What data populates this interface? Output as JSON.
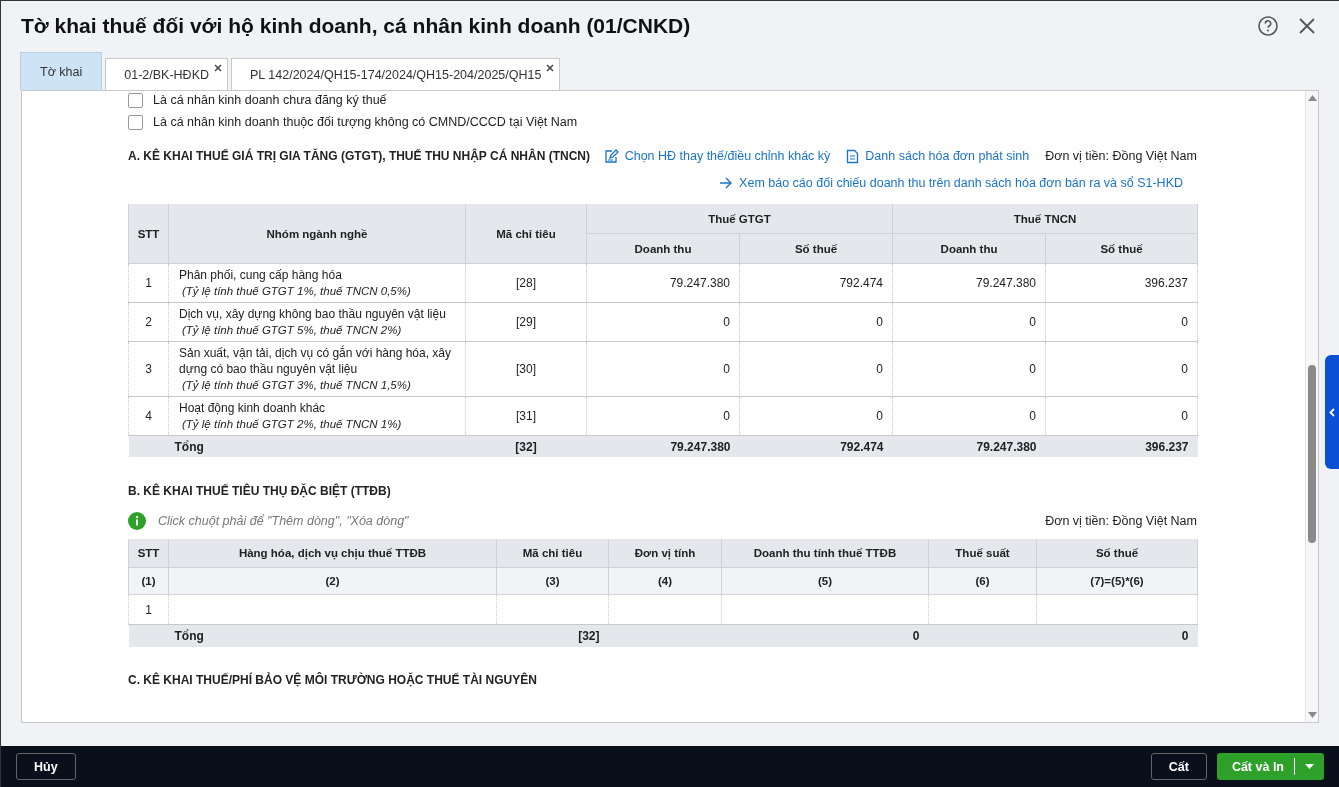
{
  "window": {
    "title": "Tờ khai thuế đối với hộ kinh doanh, cá nhân kinh doanh (01/CNKD)"
  },
  "tabs": [
    {
      "label": "Tờ khai",
      "selected": true,
      "closable": false
    },
    {
      "label": "01-2/BK-HĐKD",
      "selected": false,
      "closable": true
    },
    {
      "label": "PL 142/2024/QH15-174/2024/QH15-204/2025/QH15",
      "selected": false,
      "closable": true
    }
  ],
  "checkboxes": [
    {
      "label": "Là cá nhân kinh doanh chưa đăng ký thuế",
      "checked": false
    },
    {
      "label": "Là cá nhân kinh doanh thuộc đối tượng không có CMND/CCCD tại Việt Nam",
      "checked": false
    }
  ],
  "section_a": {
    "heading": "A. KÊ KHAI THUẾ GIÁ TRỊ GIA TĂNG (GTGT), THUẾ THU NHẬP CÁ NHÂN (TNCN)",
    "links": [
      {
        "label": "Chọn HĐ thay thế/điều chỉnh khác kỳ",
        "kind": "edit"
      },
      {
        "label": "Danh sách hóa đơn phát sinh",
        "kind": "list"
      }
    ],
    "currency": "Đơn vị tiền: Đồng Việt Nam",
    "report_link": {
      "label": "Xem báo cáo đối chiếu doanh thu trên danh sách hóa đơn bán ra và sổ S1-HKD",
      "kind": "arrow"
    },
    "columns": {
      "stt": "STT",
      "group": "Nhóm ngành nghề",
      "code": "Mã chỉ tiêu",
      "gtgt": "Thuế GTGT",
      "tncn": "Thuế TNCN",
      "sub": [
        "Doanh thu",
        "Số thuế",
        "Doanh thu",
        "Số thuế"
      ]
    },
    "rows": [
      {
        "stt": "1",
        "name": "Phân phối, cung cấp hàng hóa",
        "rate": "(Tỷ lệ tính thuế GTGT 1%, thuế TNCN 0,5%)",
        "code": "[28]",
        "values": [
          "79.247.380",
          "792.474",
          "79.247.380",
          "396.237"
        ]
      },
      {
        "stt": "2",
        "name": "Dịch vụ, xây dựng không bao thầu nguyên vật liệu",
        "rate": "(Tỷ lệ tính thuế GTGT 5%, thuế TNCN 2%)",
        "code": "[29]",
        "values": [
          "0",
          "0",
          "0",
          "0"
        ]
      },
      {
        "stt": "3",
        "name": "Sản xuất, vận tải, dịch vụ có gắn với hàng hóa, xây dựng có bao thầu nguyên vật liệu",
        "rate": "(Tỷ lệ tính thuế GTGT 3%, thuế TNCN 1,5%)",
        "code": "[30]",
        "values": [
          "0",
          "0",
          "0",
          "0"
        ]
      },
      {
        "stt": "4",
        "name": "Hoạt động kinh doanh khác",
        "rate": "(Tỷ lệ tính thuế GTGT 2%, thuế TNCN 1%)",
        "code": "[31]",
        "values": [
          "0",
          "0",
          "0",
          "0"
        ]
      }
    ],
    "total": {
      "label": "Tổng",
      "code": "[32]",
      "values": [
        "79.247.380",
        "792.474",
        "79.247.380",
        "396.237"
      ]
    }
  },
  "section_b": {
    "heading": "B. KÊ KHAI THUẾ TIÊU THỤ ĐẶC BIỆT (TTĐB)",
    "hint": "Click chuột phải để \"Thêm dòng\", \"Xóa dòng\"",
    "currency": "Đơn vị tiền: Đồng Việt Nam",
    "columns": [
      "STT",
      "Hàng hóa, dịch vụ chịu thuế TTĐB",
      "Mã chỉ tiêu",
      "Đơn vị tính",
      "Doanh thu tính thuế TTĐB",
      "Thuế suất",
      "Số thuế"
    ],
    "numbers": [
      "(1)",
      "(2)",
      "(3)",
      "(4)",
      "(5)",
      "(6)",
      "(7)=(5)*(6)"
    ],
    "rows": [
      {
        "stt": "1"
      }
    ],
    "total": {
      "label": "Tổng",
      "code": "[32]",
      "revenue": "0",
      "tax": "0"
    }
  },
  "section_c": {
    "heading": "C. KÊ KHAI THUẾ/PHÍ BẢO VỆ MÔI TRƯỜNG HOẶC THUẾ TÀI NGUYÊN"
  },
  "footer": {
    "cancel": "Hủy",
    "save": "Cất",
    "save_print": "Cất và In"
  }
}
